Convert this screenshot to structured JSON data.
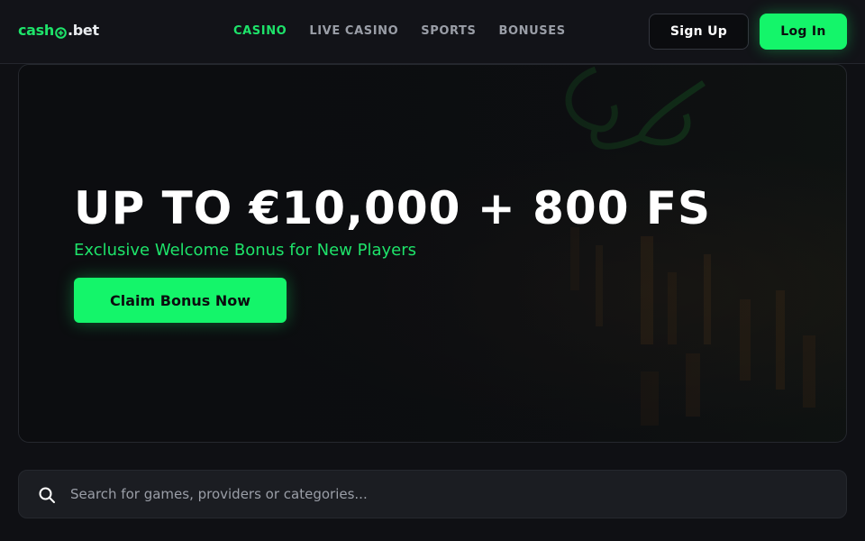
{
  "header": {
    "logo_part1": "cash",
    "logo_part2": ".bet",
    "nav": [
      {
        "label": "CASINO",
        "active": true
      },
      {
        "label": "LIVE CASINO",
        "active": false
      },
      {
        "label": "SPORTS",
        "active": false
      },
      {
        "label": "BONUSES",
        "active": false
      }
    ],
    "signup_label": "Sign Up",
    "login_label": "Log In"
  },
  "hero": {
    "title": "UP TO €10,000 + 800 FS",
    "subtitle": "Exclusive Welcome Bonus for New Players",
    "cta_label": "Claim Bonus Now"
  },
  "search": {
    "placeholder": "Search for games, providers or categories...",
    "value": ""
  },
  "colors": {
    "accent": "#14f56a",
    "accent_text": "#1ee36a",
    "background": "#0f1014",
    "nav_inactive": "#9a9ea7"
  },
  "icons": {
    "logo": "plus-circle-icon",
    "hero_decoration": "clover-icon",
    "search": "search-icon"
  }
}
